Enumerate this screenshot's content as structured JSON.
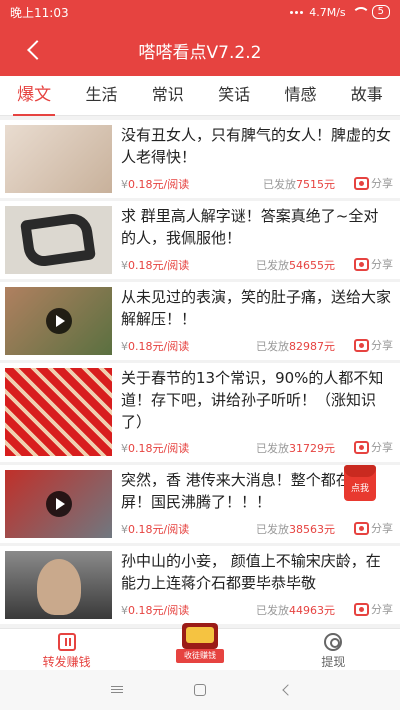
{
  "status_bar": {
    "time": "晚上11:03",
    "dots": "···",
    "speed": "4.7M/s",
    "battery": "5"
  },
  "header": {
    "title": "嗒嗒看点V7.2.2"
  },
  "tabs": [
    {
      "label": "爆文",
      "active": true
    },
    {
      "label": "生活"
    },
    {
      "label": "常识"
    },
    {
      "label": "笑话"
    },
    {
      "label": "情感"
    },
    {
      "label": "故事"
    }
  ],
  "articles": [
    {
      "headline": "没有丑女人，只有脾气的女人！脾虚的女人老得快！",
      "price_currency": "¥",
      "price": "0.18元/阅读",
      "posted_label": "已发放",
      "posted_value": "7515元",
      "share_label": "分享",
      "thumb_colors": [
        "#e9dcd0",
        "#c8b19b"
      ]
    },
    {
      "headline": "求 群里高人解字谜！答案真绝了~全对的人，我佩服他！",
      "price_currency": "¥",
      "price": "0.18元/阅读",
      "posted_label": "已发放",
      "posted_value": "54655元",
      "share_label": "分享",
      "thumb_colors": [
        "#dcd8d0",
        "#2a2a2a"
      ]
    },
    {
      "headline": "从未见过的表演，笑的肚子痛，送给大家解解压！！",
      "price_currency": "¥",
      "price": "0.18元/阅读",
      "posted_label": "已发放",
      "posted_value": "82987元",
      "share_label": "分享",
      "thumb_colors": [
        "#b08060",
        "#5a7040"
      ]
    },
    {
      "headline": "关于春节的13个常识，90%的人都不知道！存下吧，讲给孙子听听！（涨知识了）",
      "price_currency": "¥",
      "price": "0.18元/阅读",
      "posted_label": "已发放",
      "posted_value": "31729元",
      "share_label": "分享",
      "thumb_colors": [
        "#d81e1e",
        "#f0d0b0"
      ]
    },
    {
      "headline": "突然，香 港传来大消息！整个都在刷屏！国民沸腾了！！！",
      "price_currency": "¥",
      "price": "0.18元/阅读",
      "posted_label": "已发放",
      "posted_value": "38563元",
      "share_label": "分享",
      "thumb_colors": [
        "#c0302a",
        "#707880"
      ]
    },
    {
      "headline": "孙中山的小妾， 颜值上不输宋庆龄，在能力上连蒋介石都要毕恭毕敬",
      "price_currency": "¥",
      "price": "0.18元/阅读",
      "posted_label": "已发放",
      "posted_value": "44963元",
      "share_label": "分享",
      "thumb_colors": [
        "#8a8a8a",
        "#3a3a3a"
      ]
    }
  ],
  "float_red_packet": {
    "label": "点我"
  },
  "bottom_nav": [
    {
      "label": "转发赚钱",
      "icon": "forward-icon",
      "active": true
    },
    {
      "label": "",
      "badge": "收徒赚钱",
      "icon": "collect-badge"
    },
    {
      "label": "提现",
      "icon": "withdraw-icon"
    }
  ],
  "colors": {
    "brand": "#e64340",
    "text": "#222222",
    "muted": "#999999"
  }
}
